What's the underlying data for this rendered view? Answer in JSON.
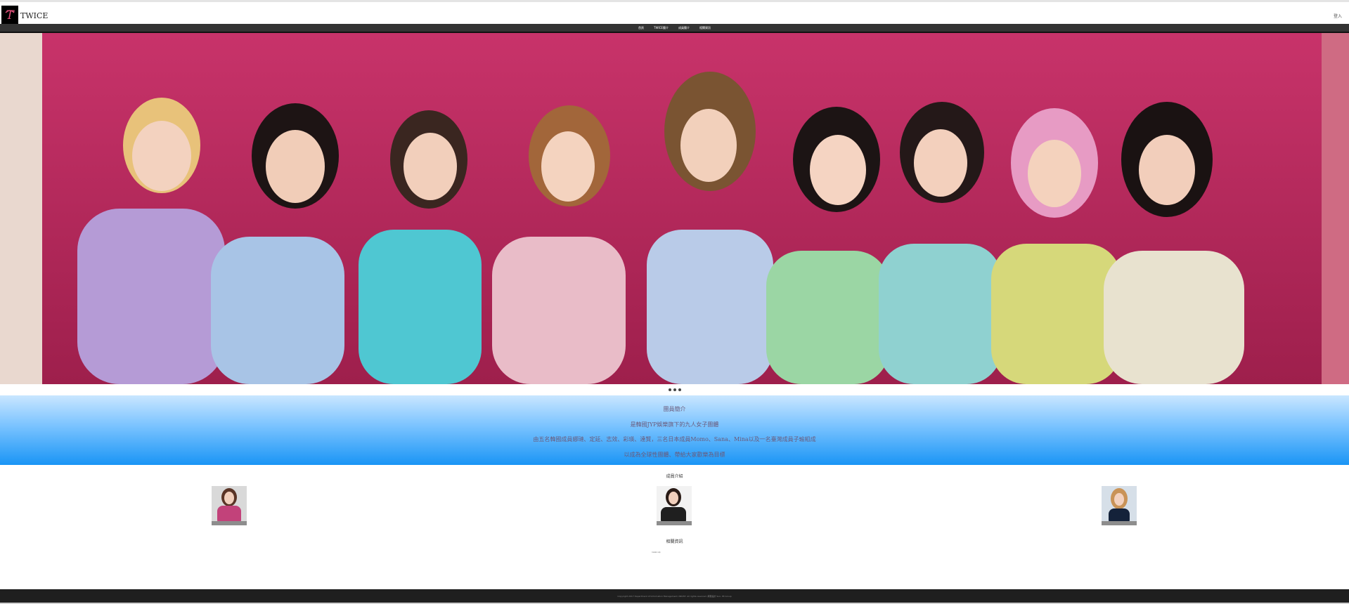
{
  "header": {
    "brand": "TWICE",
    "login": "登入"
  },
  "nav": {
    "items": [
      "首頁",
      "TWICE簡介",
      "成員簡介",
      "相關資訊"
    ]
  },
  "carousel": {
    "dots": 3
  },
  "intro": {
    "title": "團員簡介",
    "line1": "是韓國JYP娛樂旗下的九人女子團體",
    "line2": "由五名韓國成員娜璉、定延、志效、彩瑛、達賢，三名日本成員Momo、Sana、Mina以及一名臺灣成員子瑜組成",
    "line3": "以成為全球性團體、帶給大家歡樂為目標"
  },
  "members": {
    "title": "成員介紹",
    "cards": [
      {
        "caption": ""
      },
      {
        "caption": ""
      },
      {
        "caption": ""
      }
    ]
  },
  "news": {
    "title": "相關資訊",
    "text": "news:up"
  },
  "footer": {
    "text": "Copyright 2017 Department of Information Management, NKUST. All rights reserved. 網頁設計 Sun, IM Group"
  }
}
